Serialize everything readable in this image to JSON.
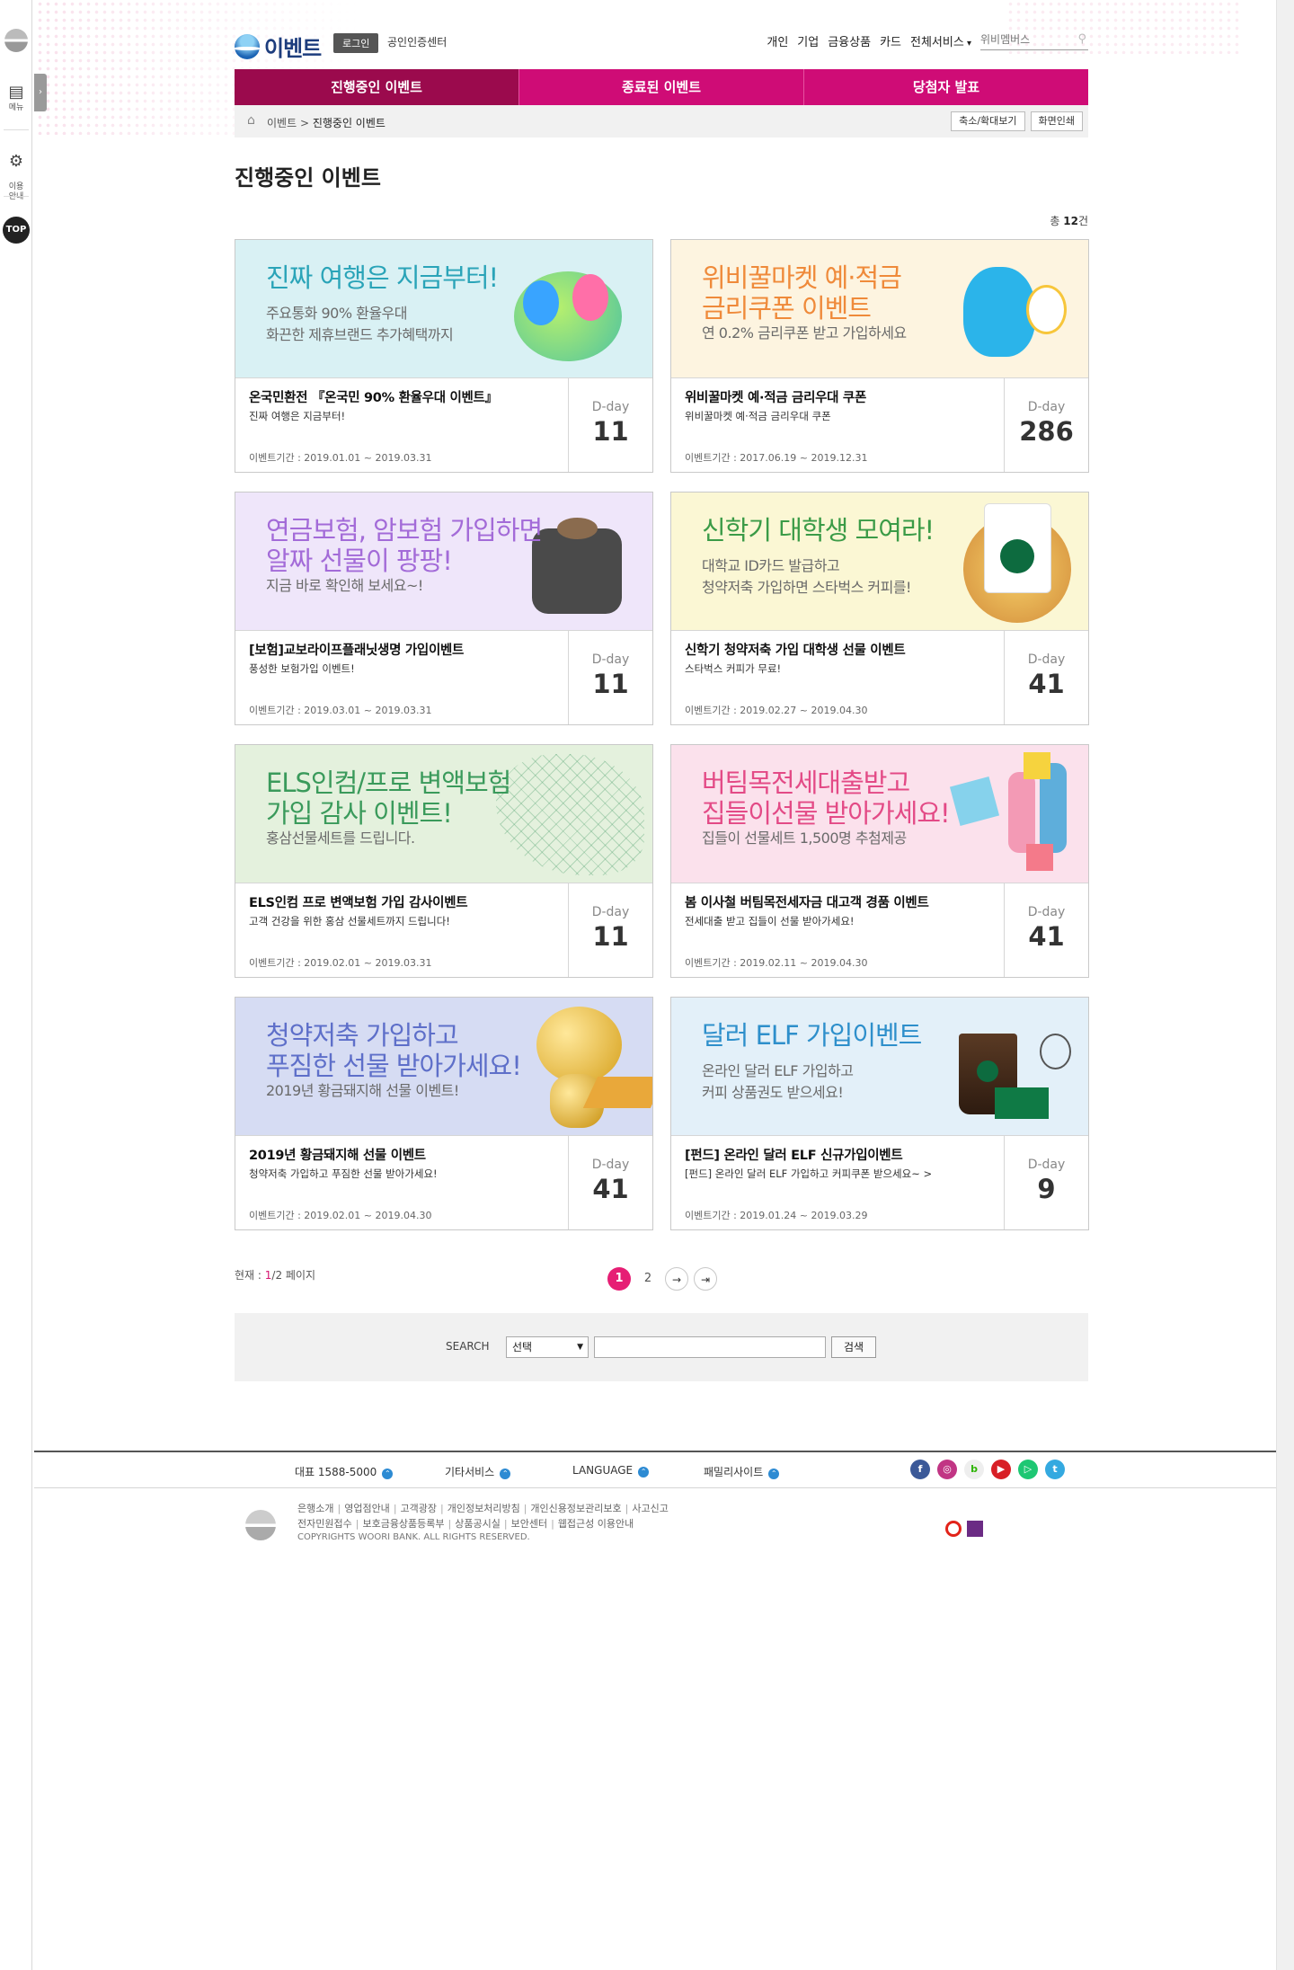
{
  "quickbar": {
    "menu_label": "메뉴",
    "guide_label": "이용\n안내",
    "top_label": "TOP",
    "toggle_icon": "chevron-right-icon"
  },
  "header": {
    "logo_text": "이벤트",
    "login_label": "로그인",
    "cert_label": "공인인증센터",
    "gnb": [
      "개인",
      "기업",
      "금융상품",
      "카드",
      "전체서비스"
    ],
    "search_placeholder": "위비멤버스"
  },
  "tabs": [
    {
      "label": "진행중인 이벤트",
      "active": true
    },
    {
      "label": "종료된 이벤트",
      "active": false
    },
    {
      "label": "당첨자 발표",
      "active": false
    }
  ],
  "breadcrumb": {
    "items": [
      "이벤트",
      "진행중인 이벤트"
    ],
    "zoom_label": "축소/확대보기",
    "print_label": "화면인쇄"
  },
  "page_title": "진행중인 이벤트",
  "total": {
    "prefix": "총 ",
    "count": "12",
    "suffix": "건"
  },
  "events": [
    {
      "banner_title": "진짜 여행은 지금부터!",
      "banner_sub": "주요통화 90% 환율우대\n화끈한 제휴브랜드 추가혜택까지",
      "title": "온국민환전 『온국민 90% 환율우대 이벤트』",
      "subtitle": "진짜 여행은 지금부터!",
      "period": "이벤트기간 : 2019.01.01 ~ 2019.03.31",
      "dday_label": "D-day",
      "dday": "11",
      "bg": "#d9f1f4",
      "title_color": "#2aa4b8"
    },
    {
      "banner_title": "위비꿀마켓 예·적금\n금리쿠폰 이벤트",
      "banner_sub": "연 0.2% 금리쿠폰 받고 가입하세요",
      "title": "위비꿀마켓 예·적금 금리우대 쿠폰",
      "subtitle": "위비꿀마켓 예·적금 금리우대 쿠폰",
      "period": "이벤트기간 : 2017.06.19 ~ 2019.12.31",
      "dday_label": "D-day",
      "dday": "286",
      "bg": "#fdf4e0",
      "title_color": "#ef8a3a"
    },
    {
      "banner_title": "연금보험, 암보험 가입하면\n알짜 선물이 팡팡!",
      "banner_sub": "지금 바로 확인해 보세요~!",
      "title": "[보험]교보라이프플래닛생명 가입이벤트",
      "subtitle": "풍성한 보험가입 이벤트!",
      "period": "이벤트기간 : 2019.03.01 ~ 2019.03.31",
      "dday_label": "D-day",
      "dday": "11",
      "bg": "#efe6fa",
      "title_color": "#a36bd8"
    },
    {
      "banner_title": "신학기 대학생 모여라!",
      "banner_sub": "대학교 ID카드 발급하고\n청약저축 가입하면 스타벅스 커피를!",
      "title": "신학기 청약저축 가입 대학생 선물 이벤트",
      "subtitle": "스타벅스 커피가 무료!",
      "period": "이벤트기간 : 2019.02.27 ~ 2019.04.30",
      "dday_label": "D-day",
      "dday": "41",
      "bg": "#fbf7d4",
      "title_color": "#3b9b47"
    },
    {
      "banner_title": "ELS인컴/프로 변액보험\n가입 감사 이벤트!",
      "banner_sub": "홍삼선물세트를 드립니다.",
      "title": "ELS인컴 프로 변액보험 가입 감사이벤트",
      "subtitle": "고객 건강을 위한 홍삼 선물세트까지 드립니다!",
      "period": "이벤트기간 : 2019.02.01 ~ 2019.03.31",
      "dday_label": "D-day",
      "dday": "11",
      "bg": "#e4f1dd",
      "title_color": "#3a9a5b"
    },
    {
      "banner_title": "버팀목전세대출받고\n집들이선물 받아가세요!",
      "banner_sub": "집들이 선물세트 1,500명 추첨제공",
      "title": "봄 이사철 버팀목전세자금 대고객 경품 이벤트",
      "subtitle": "전세대출 받고 집들이 선물 받아가세요!",
      "period": "이벤트기간 : 2019.02.11 ~ 2019.04.30",
      "dday_label": "D-day",
      "dday": "41",
      "bg": "#fbe1ec",
      "title_color": "#e34a86"
    },
    {
      "banner_title": "청약저축 가입하고\n푸짐한 선물 받아가세요!",
      "banner_sub": "2019년 황금돼지해 선물 이벤트!",
      "title": "2019년 황금돼지해 선물 이벤트",
      "subtitle": "청약저축 가입하고 푸짐한 선물 받아가세요!",
      "period": "이벤트기간 : 2019.02.01 ~ 2019.04.30",
      "dday_label": "D-day",
      "dday": "41",
      "bg": "#d6dcf3",
      "title_color": "#5e6fc9"
    },
    {
      "banner_title": "달러 ELF 가입이벤트",
      "banner_sub": "온라인 달러 ELF 가입하고\n커피 상품권도 받으세요!",
      "title": "[펀드] 온라인 달러 ELF 신규가입이벤트",
      "subtitle": "[펀드] 온라인 달러 ELF 가입하고 커피쿠폰 받으세요~ >",
      "period": "이벤트기간 : 2019.01.24 ~ 2019.03.29",
      "dday_label": "D-day",
      "dday": "9",
      "bg": "#e3f0f9",
      "title_color": "#2e8fcb"
    }
  ],
  "pagination": {
    "current_prefix": "현재 : ",
    "current": "1",
    "total": "/2",
    "suffix": " 페이지",
    "pages": [
      "1",
      "2"
    ],
    "next_icon": "arrow-right-icon",
    "last_icon": "arrow-last-icon"
  },
  "search": {
    "label": "SEARCH",
    "select_value": "선택",
    "input_value": "",
    "button_label": "검색"
  },
  "footer": {
    "menus": [
      "대표 1588-5000",
      "기타서비스",
      "LANGUAGE",
      "패밀리사이트"
    ],
    "sns": [
      "facebook-icon",
      "instagram-icon",
      "blog-icon",
      "youtube-icon",
      "play-icon",
      "twitter-icon"
    ],
    "links_row1": [
      "은행소개",
      "영업점안내",
      "고객광장",
      "개인정보처리방침",
      "개인신용정보관리보호",
      "사고신고"
    ],
    "links_row2": [
      "전자민원접수",
      "보호금융상품등록부",
      "상품공시실",
      "보안센터",
      "웹접근성 이용안내"
    ],
    "copyright": "COPYRIGHTS WOORI BANK. ALL RIGHTS RESERVED."
  }
}
